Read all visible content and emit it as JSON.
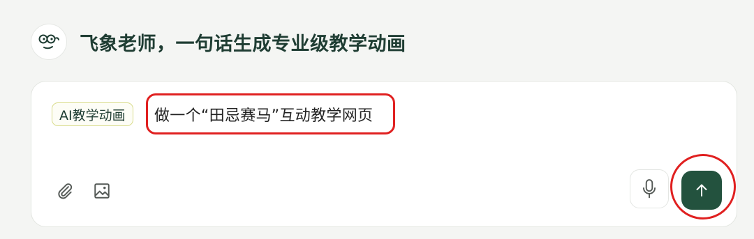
{
  "header": {
    "title": "飞象老师，一句话生成专业级教学动画",
    "avatar_icon": "cartoon-face-with-glasses-icon"
  },
  "composer": {
    "mode_tag": "AI教学动画",
    "prompt_text": "做一个“田忌赛马”互动教学网页",
    "attach_icon": "paperclip-icon",
    "image_icon": "image-icon",
    "mic_icon": "microphone-icon",
    "send_icon": "arrow-up-icon"
  },
  "colors": {
    "background": "#f4f5f3",
    "brand_green": "#23523e",
    "title_text": "#1f3d33",
    "highlight_red": "#e02020",
    "tag_border": "#d9dc8c"
  }
}
